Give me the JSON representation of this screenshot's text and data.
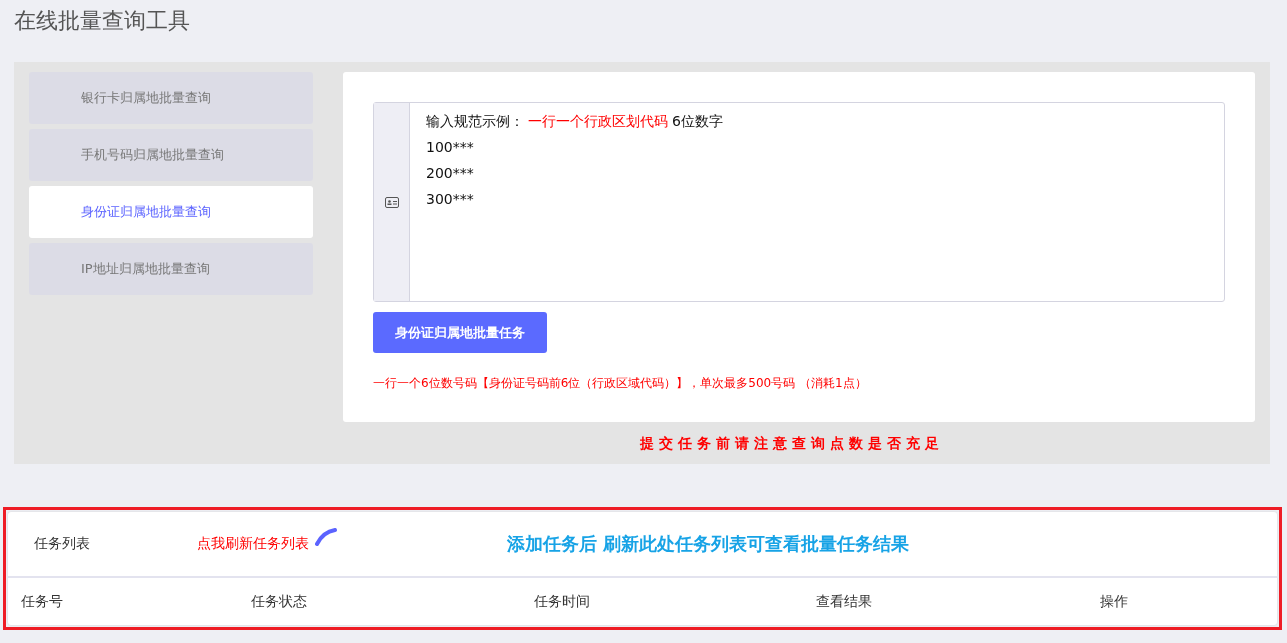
{
  "page_title": "在线批量查询工具",
  "sidebar": {
    "items": [
      {
        "label": "银行卡归属地批量查询",
        "selected": false
      },
      {
        "label": "手机号码归属地批量查询",
        "selected": false
      },
      {
        "label": "身份证归属地批量查询",
        "selected": true
      },
      {
        "label": "IP地址归属地批量查询",
        "selected": false
      }
    ]
  },
  "input": {
    "hint_label": "输入规范示例：",
    "hint_rule": "一行一个行政区划代码",
    "hint_note": "6位数字",
    "example_lines": [
      "100***",
      "200***",
      "300***"
    ]
  },
  "submit_button": "身份证归属地批量任务",
  "note": "一行一个6位数号码【身份证号码前6位（行政区域代码）】，单次最多500号码 （消耗1点）",
  "warning": "提交任务前请注意查询点数是否充足",
  "task_panel": {
    "highlighted": true,
    "title": "任务列表",
    "refresh_link": "点我刷新任务列表",
    "banner": "添加任务后 刷新此处任务列表可查看批量任务结果",
    "columns": [
      "任务号",
      "任务状态",
      "任务时间",
      "查看结果",
      "操作"
    ]
  }
}
